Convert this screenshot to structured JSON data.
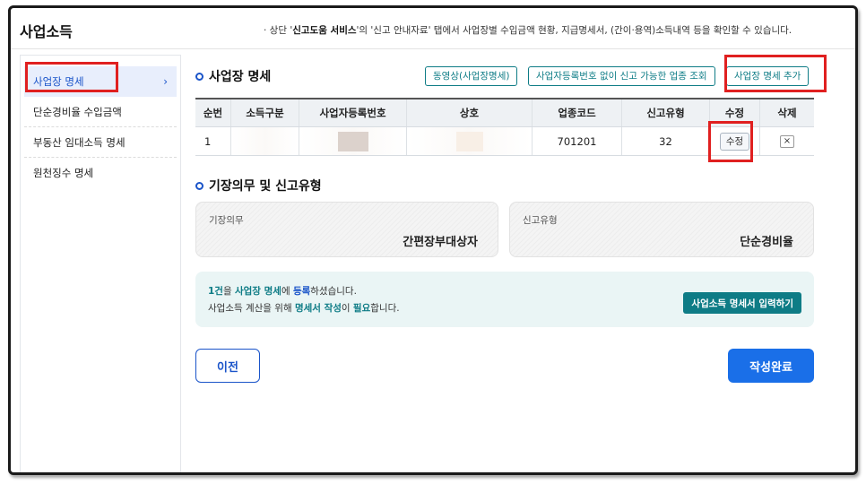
{
  "header": {
    "title": "사업소득",
    "notice_prefix": "· 상단 '",
    "notice_bold": "신고도움 서비스",
    "notice_suffix": "'의 '신고 안내자료' 탭에서 사업장별 수입금액 현황, 지급명세서, (간이·용역)소득내역 등을 확인할 수 있습니다."
  },
  "sidebar": {
    "items": [
      {
        "label": "사업장 명세",
        "active": true
      },
      {
        "label": "단순경비율 수입금액",
        "active": false
      },
      {
        "label": "부동산 임대소득 명세",
        "active": false
      },
      {
        "label": "원천징수 명세",
        "active": false
      }
    ]
  },
  "business_section": {
    "title": "사업장 명세",
    "btn_video": "동영상(사업장명세)",
    "btn_lookup": "사업자등록번호 없이 신고 가능한 업종 조회",
    "btn_add": "사업장 명세 추가"
  },
  "table": {
    "headers": [
      "순번",
      "소득구분",
      "사업자등록번호",
      "상호",
      "업종코드",
      "신고유형",
      "수정",
      "삭제"
    ],
    "rows": [
      {
        "no": "1",
        "income_type": "",
        "reg_no": "",
        "name": "",
        "code": "701201",
        "report_type": "32",
        "edit_label": "수정",
        "delete_label": "×"
      }
    ]
  },
  "bookkeeping_section": {
    "title": "기장의무 및 신고유형",
    "duty_label": "기장의무",
    "duty_value": "간편장부대상자",
    "type_label": "신고유형",
    "type_value": "단순경비율"
  },
  "notice": {
    "line1_count": "1건",
    "line1_mid": "을 ",
    "line1_hl": "사업장 명세",
    "line1_mid2": "에 ",
    "line1_hl2": "등록",
    "line1_end": "하셨습니다.",
    "line2_start": "사업소득 계산을 위해 ",
    "line2_hl": "명세서 작성",
    "line2_mid": "이 ",
    "line2_hl2": "필요",
    "line2_end": "합니다.",
    "btn_input": "사업소득 명세서 입력하기"
  },
  "footer": {
    "btn_prev": "이전",
    "btn_done": "작성완료"
  },
  "colors": {
    "accent_blue": "#1a54c9",
    "teal": "#0e7c86",
    "highlight_red": "#e02020"
  }
}
